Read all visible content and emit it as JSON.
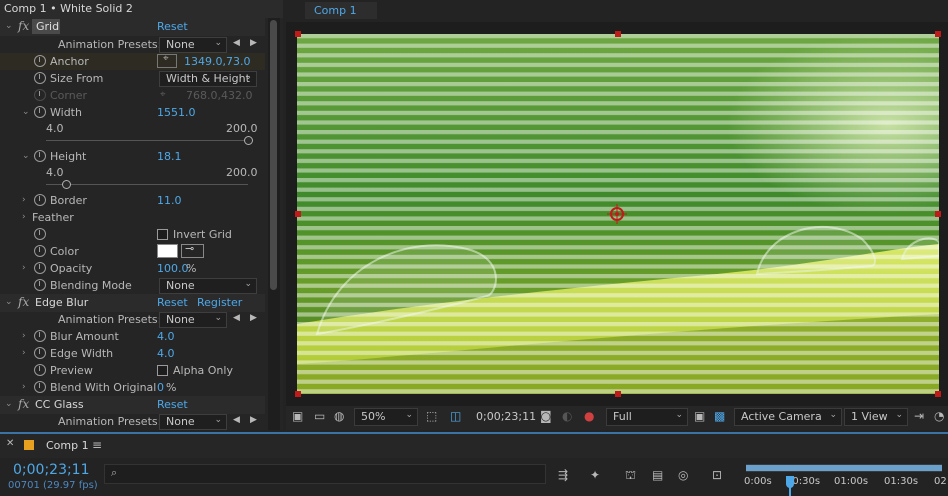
{
  "panel": {
    "title": "Comp 1 • White Solid 2"
  },
  "grid": {
    "name": "Grid",
    "reset": "Reset",
    "presets_label": "Animation Presets:",
    "presets_value": "None",
    "anchor_label": "Anchor",
    "anchor_value": "1349.0,73.0",
    "size_from_label": "Size From",
    "size_from_value": "Width & Height",
    "corner_label": "Corner",
    "corner_value": "768.0,432.0",
    "width_label": "Width",
    "width_value": "1551.0",
    "width_min": "4.0",
    "width_max": "200.0",
    "height_label": "Height",
    "height_value": "18.1",
    "height_min": "4.0",
    "height_max": "200.0",
    "border_label": "Border",
    "border_value": "11.0",
    "feather_label": "Feather",
    "invert_label": "Invert Grid",
    "color_label": "Color",
    "opacity_label": "Opacity",
    "opacity_value": "100.0",
    "opacity_unit": "%",
    "blending_label": "Blending Mode",
    "blending_value": "None"
  },
  "edge_blur": {
    "name": "Edge Blur",
    "reset": "Reset",
    "register": "Register",
    "presets_label": "Animation Presets:",
    "presets_value": "None",
    "blur_label": "Blur Amount",
    "blur_value": "4.0",
    "edge_width_label": "Edge Width",
    "edge_width_value": "4.0",
    "preview_label": "Preview",
    "alpha_only_label": "Alpha Only",
    "blend_label": "Blend With Original",
    "blend_value": "0",
    "blend_unit": "%"
  },
  "cc_glass": {
    "name": "CC Glass",
    "reset": "Reset",
    "presets_label": "Animation Presets:",
    "presets_value": "None"
  },
  "viewer": {
    "tab": "Comp 1",
    "zoom": "50%",
    "timecode": "0;00;23;11",
    "resolution": "Full",
    "camera": "Active Camera",
    "views": "1 View"
  },
  "timeline": {
    "tab": "Comp 1",
    "timecode": "0;00;23;11",
    "frame_info": "00701 (29.97 fps)",
    "ticks": [
      "0:00s",
      "00:30s",
      "01:00s",
      "01:30s",
      "02"
    ]
  },
  "colors": {
    "accent": "#4ea8e8",
    "image_green": "#4f9a2c",
    "handle_red": "#c01a1a"
  }
}
